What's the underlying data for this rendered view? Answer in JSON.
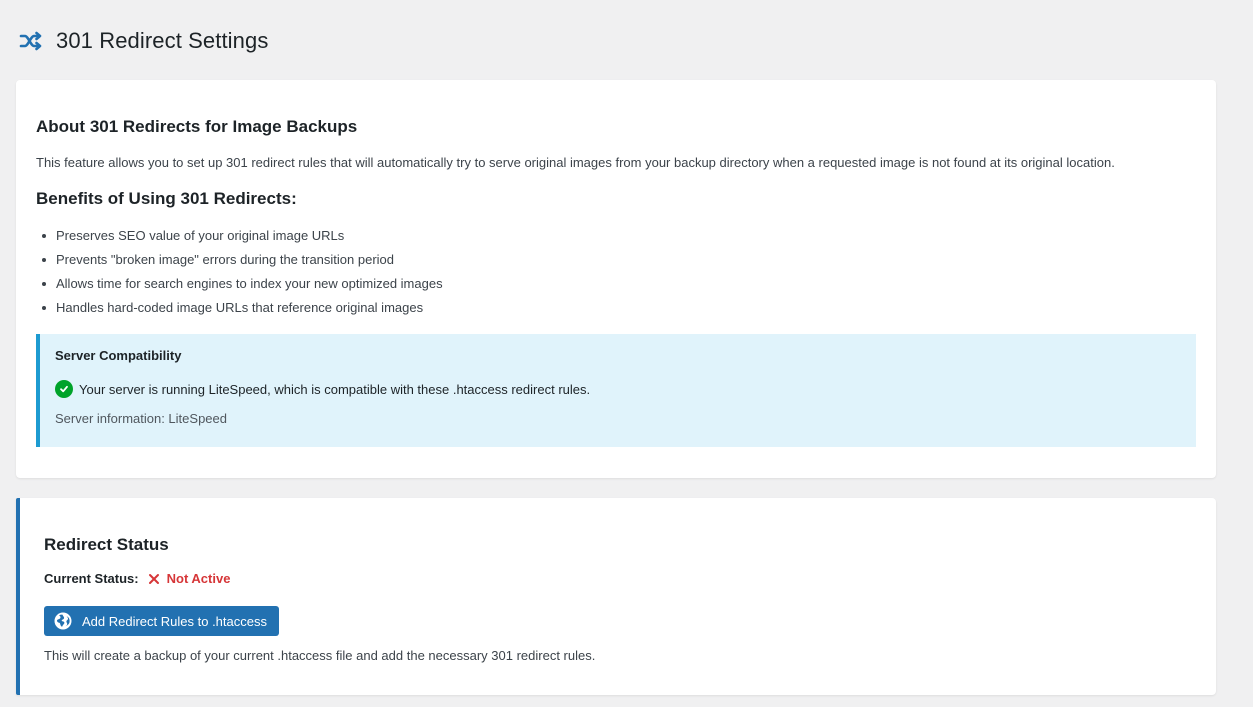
{
  "header": {
    "icon": "shuffle-icon",
    "title": "301 Redirect Settings"
  },
  "about": {
    "heading": "About 301 Redirects for Image Backups",
    "description": "This feature allows you to set up 301 redirect rules that will automatically try to serve original images from your backup directory when a requested image is not found at its original location.",
    "benefits_heading": "Benefits of Using 301 Redirects:",
    "benefits": [
      "Preserves SEO value of your original image URLs",
      "Prevents \"broken image\" errors during the transition period",
      "Allows time for search engines to index your new optimized images",
      "Handles hard-coded image URLs that reference original images"
    ],
    "compatibility": {
      "title": "Server Compatibility",
      "icon": "check-circle-icon",
      "message": "Your server is running LiteSpeed, which is compatible with these .htaccess redirect rules.",
      "server_info": "Server information: LiteSpeed"
    }
  },
  "status": {
    "heading": "Redirect Status",
    "label": "Current Status:",
    "value": "Not Active",
    "value_icon": "x-icon",
    "button_label": "Add Redirect Rules to .htaccess",
    "button_icon": "globe-icon",
    "note": "This will create a backup of your current .htaccess file and add the necessary 301 redirect rules."
  },
  "colors": {
    "accent": "#2271b1",
    "notice_bg": "#e0f3fb",
    "notice_border": "#1d9bd1",
    "success": "#00a32a",
    "error": "#d63638"
  }
}
